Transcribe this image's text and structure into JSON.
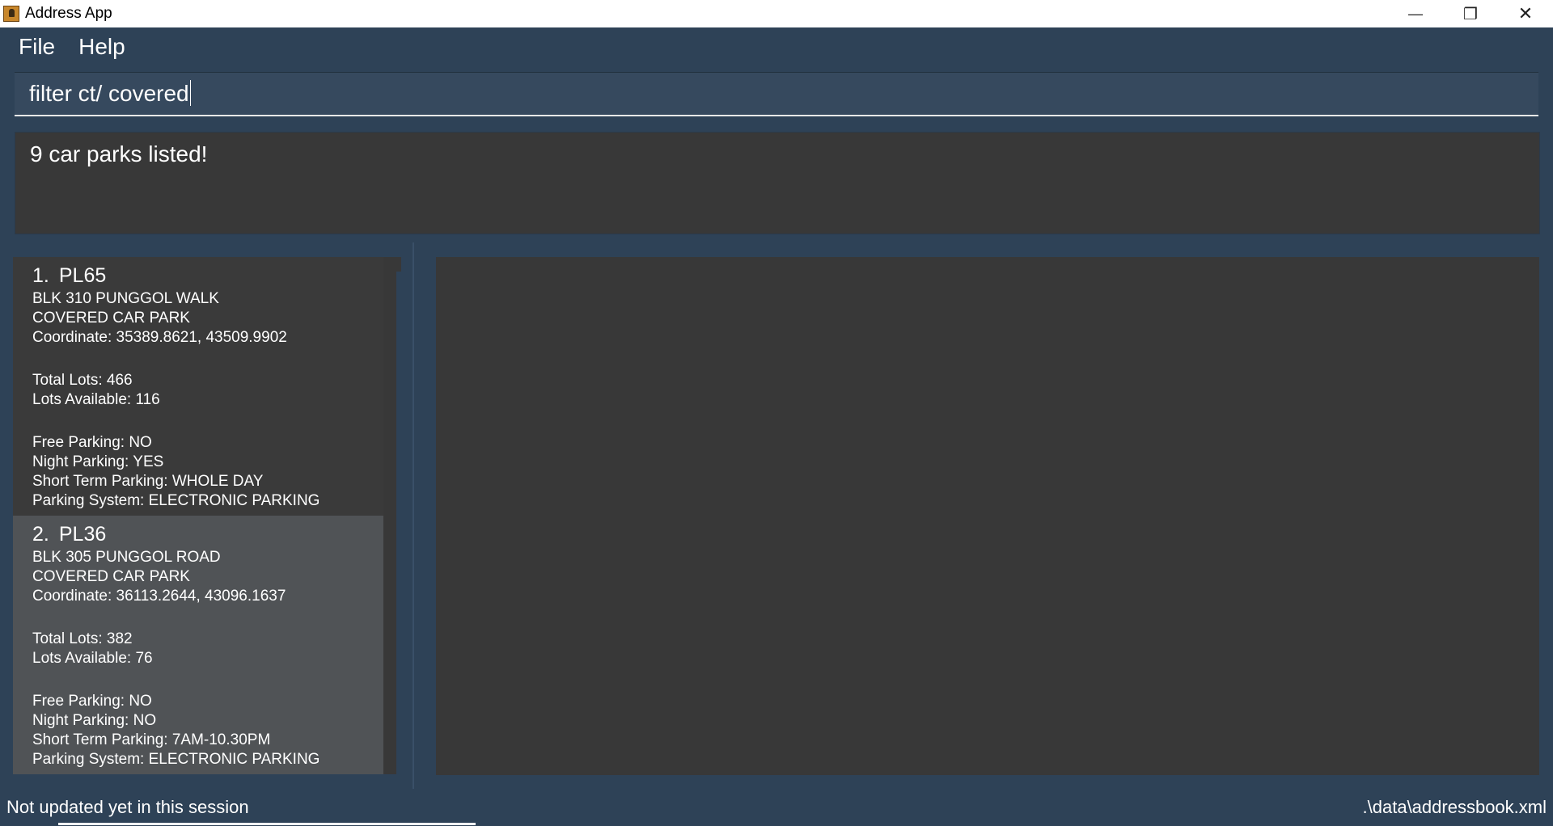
{
  "window": {
    "title": "Address App",
    "minimize_glyph": "—",
    "restore_glyph": "❐",
    "close_glyph": "✕"
  },
  "menu": {
    "file": "File",
    "help": "Help"
  },
  "command": {
    "value": "filter ct/ covered"
  },
  "result": {
    "text": "9 car parks listed!"
  },
  "carparks": [
    {
      "index": "1.",
      "code": "PL65",
      "address": "BLK 310 PUNGGOL WALK",
      "type": "COVERED CAR PARK",
      "coordinate": "Coordinate: 35389.8621, 43509.9902",
      "total_lots": "Total Lots: 466",
      "lots_available": "Lots Available: 116",
      "free_parking": "Free Parking: NO",
      "night_parking": "Night Parking: YES",
      "short_term": "Short Term Parking: WHOLE DAY",
      "system": "Parking System: ELECTRONIC PARKING"
    },
    {
      "index": "2.",
      "code": "PL36",
      "address": "BLK 305 PUNGGOL ROAD",
      "type": "COVERED CAR PARK",
      "coordinate": "Coordinate: 36113.2644, 43096.1637",
      "total_lots": "Total Lots: 382",
      "lots_available": "Lots Available: 76",
      "free_parking": "Free Parking: NO",
      "night_parking": "Night Parking: NO",
      "short_term": "Short Term Parking: 7AM-10.30PM",
      "system": "Parking System: ELECTRONIC PARKING"
    }
  ],
  "status": {
    "sync": "Not updated yet in this session",
    "file_path": ".\\data\\addressbook.xml"
  },
  "colors": {
    "chrome": "#2e4257",
    "panel": "#383838",
    "selected_card": "#505356"
  }
}
